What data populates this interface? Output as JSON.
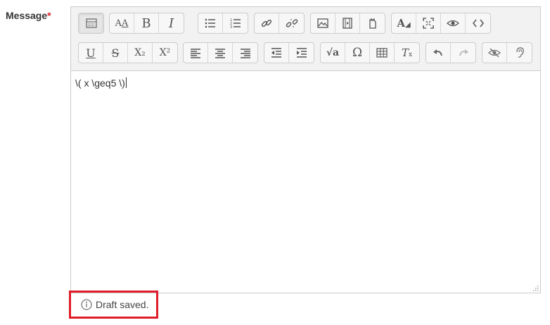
{
  "field": {
    "label": "Message",
    "required_mark": "*"
  },
  "toolbar": {
    "row1": [
      [
        {
          "icon": "show-more-buttons-icon"
        }
      ],
      [
        {
          "icon": "paragraph-styles-icon"
        },
        {
          "icon": "bold-icon",
          "glyph": "B"
        },
        {
          "icon": "italic-icon",
          "glyph": "I"
        }
      ],
      [
        {
          "icon": "unordered-list-icon"
        },
        {
          "icon": "ordered-list-icon"
        }
      ],
      [
        {
          "icon": "link-icon"
        },
        {
          "icon": "unlink-icon"
        }
      ],
      [
        {
          "icon": "image-icon"
        },
        {
          "icon": "media-icon"
        },
        {
          "icon": "manage-files-icon"
        }
      ],
      [
        {
          "icon": "font-color-icon"
        },
        {
          "icon": "fullscreen-icon"
        },
        {
          "icon": "preview-icon"
        },
        {
          "icon": "html-icon"
        }
      ]
    ],
    "row2": [
      [
        {
          "icon": "underline-icon",
          "glyph": "U"
        },
        {
          "icon": "strikethrough-icon",
          "glyph": "S"
        },
        {
          "icon": "subscript-icon",
          "glyph": "X₂"
        },
        {
          "icon": "superscript-icon",
          "glyph": "X²"
        }
      ],
      [
        {
          "icon": "align-left-icon"
        },
        {
          "icon": "align-center-icon"
        },
        {
          "icon": "align-right-icon"
        }
      ],
      [
        {
          "icon": "outdent-icon"
        },
        {
          "icon": "indent-icon"
        }
      ],
      [
        {
          "icon": "equation-icon"
        },
        {
          "icon": "special-character-icon",
          "glyph": "Ω"
        },
        {
          "icon": "table-icon"
        },
        {
          "icon": "clear-formatting-icon"
        }
      ],
      [
        {
          "icon": "undo-icon"
        },
        {
          "icon": "redo-icon"
        }
      ],
      [
        {
          "icon": "accessibility-checker-icon"
        },
        {
          "icon": "screenreader-helper-icon"
        }
      ]
    ]
  },
  "editor": {
    "content": "\\( x \\geq5 \\)"
  },
  "status": {
    "text": "Draft saved."
  }
}
